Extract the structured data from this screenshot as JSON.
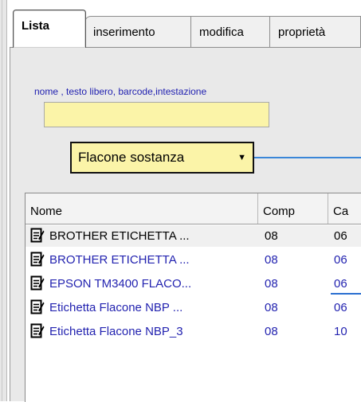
{
  "tabs": [
    {
      "label": "Lista",
      "active": true
    },
    {
      "label": "inserimento",
      "active": false
    },
    {
      "label": "modifica",
      "active": false
    },
    {
      "label": "proprietà",
      "active": false
    }
  ],
  "search": {
    "label": "nome , testo libero, barcode,intestazione",
    "value": "",
    "placeholder": ""
  },
  "filter": {
    "selected": "Flacone sostanza",
    "chevron_icon": "triangle-down"
  },
  "table": {
    "columns": [
      "Nome",
      "Comp",
      "Ca"
    ],
    "rows": [
      {
        "icon": "document-edit-icon",
        "name": "BROTHER ETICHETTA ...",
        "comp": "08",
        "ca": "06",
        "color": "#000000",
        "selected": true
      },
      {
        "icon": "document-edit-icon",
        "name": "BROTHER ETICHETTA ...",
        "comp": "08",
        "ca": "06",
        "color": "#2323b0",
        "selected": false
      },
      {
        "icon": "document-edit-icon",
        "name": "EPSON TM3400 FLACO...",
        "comp": "08",
        "ca": "06",
        "color": "#2323b0",
        "selected": false
      },
      {
        "icon": "document-edit-icon",
        "name": "Etichetta Flacone NBP ...",
        "comp": "08",
        "ca": "06",
        "color": "#2323b0",
        "selected": false
      },
      {
        "icon": "document-edit-icon",
        "name": "Etichetta Flacone NBP_3",
        "comp": "08",
        "ca": "10",
        "color": "#2323b0",
        "selected": false
      }
    ]
  },
  "colors": {
    "input_bg": "#fbf4a8",
    "panel_bg": "#e9e9e9",
    "label_blue": "#1f1fb0",
    "connector_blue": "#3a86d8"
  }
}
